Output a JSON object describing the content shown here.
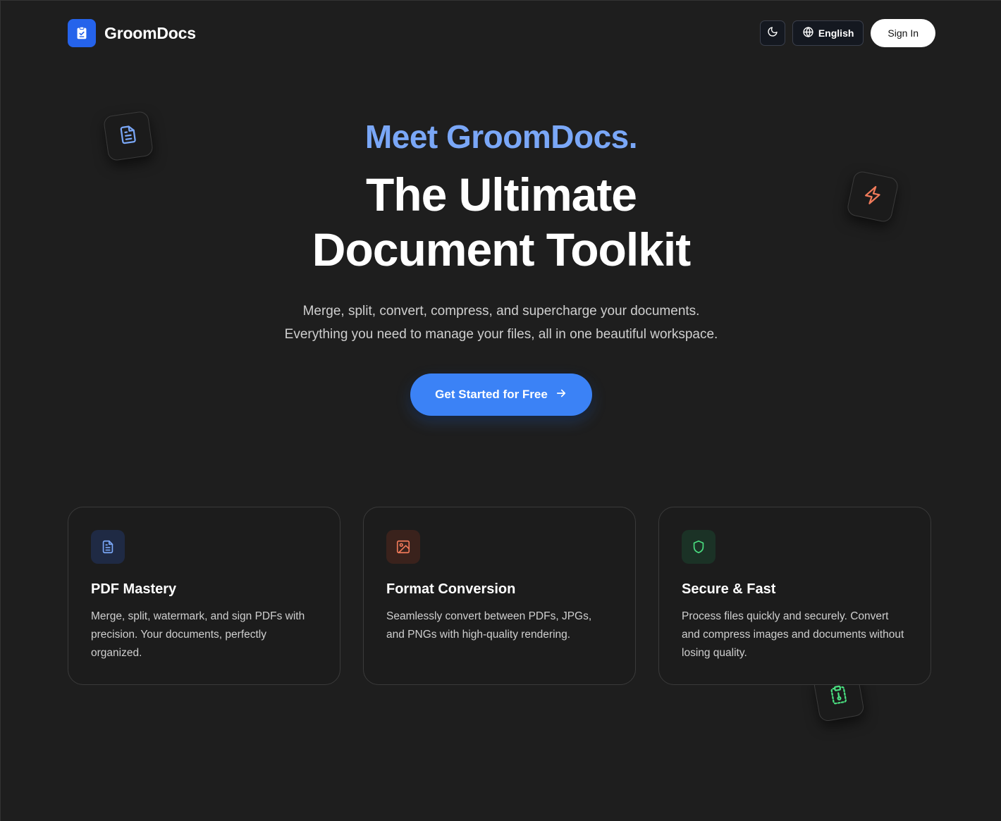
{
  "header": {
    "app_name": "GroomDocs",
    "language_label": "English",
    "sign_in_label": "Sign In",
    "logo_icon": "clipboard-check-icon",
    "theme_icon": "moon-icon",
    "language_icon": "globe-icon"
  },
  "hero": {
    "pretitle": "Meet GroomDocs.",
    "title_line1": "The Ultimate",
    "title_line2": "Document Toolkit",
    "subtitle_line1": "Merge, split, convert, compress, and supercharge your documents.",
    "subtitle_line2": "Everything you need to manage your files, all in one beautiful workspace.",
    "cta_label": "Get Started for Free",
    "cta_icon": "arrow-right-icon"
  },
  "floating_icons": [
    "file-text-icon",
    "zap-icon",
    "clipboard-icon"
  ],
  "features": [
    {
      "title": "PDF Mastery",
      "description": "Merge, split, watermark, and sign PDFs with precision. Your documents, perfectly organized.",
      "icon": "file-text-icon",
      "accent": "#7aa7f7"
    },
    {
      "title": "Format Conversion",
      "description": "Seamlessly convert between PDFs, JPGs, and PNGs with high-quality rendering.",
      "icon": "image-icon",
      "accent": "#f07a5a"
    },
    {
      "title": "Secure & Fast",
      "description": "Process files quickly and securely. Convert and compress images and documents without losing quality.",
      "icon": "shield-icon",
      "accent": "#4ade80"
    }
  ],
  "colors": {
    "background": "#1e1e1e",
    "brand_blue": "#2563eb",
    "cta_blue": "#3b82f6",
    "pretitle_blue": "#7aa7f7"
  }
}
